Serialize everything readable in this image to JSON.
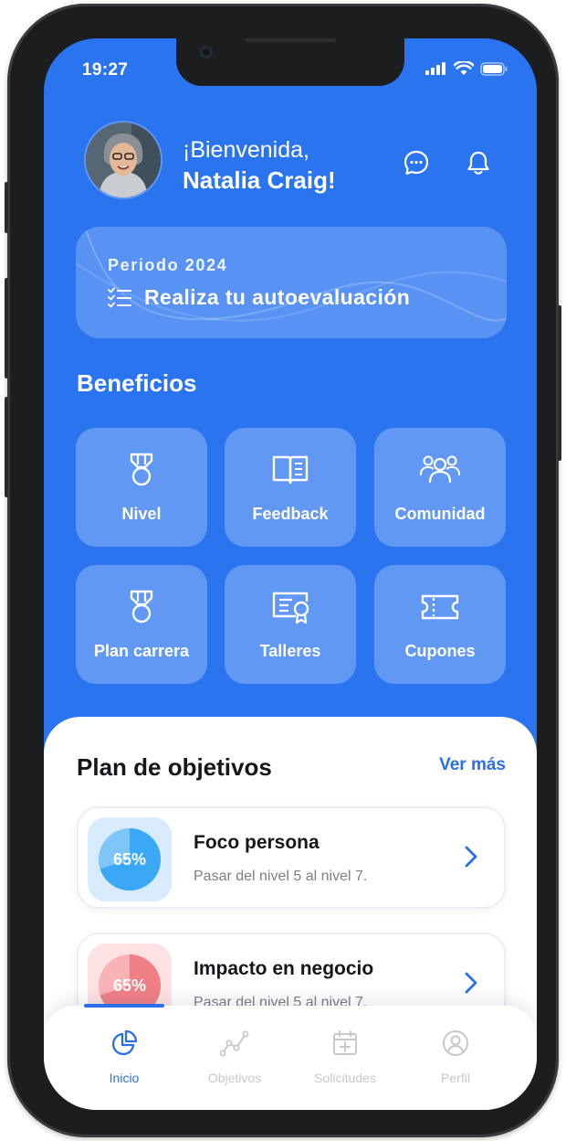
{
  "status_bar": {
    "time": "19:27"
  },
  "header": {
    "greeting": "¡Bienvenida,",
    "user_name": "Natalia Craig!"
  },
  "period_card": {
    "subtitle": "Periodo 2024",
    "cta_label": "Realiza tu autoevaluación"
  },
  "benefits": {
    "title": "Beneficios",
    "items": [
      {
        "label": "Nivel",
        "icon": "medal-icon"
      },
      {
        "label": "Feedback",
        "icon": "book-icon"
      },
      {
        "label": "Comunidad",
        "icon": "community-icon"
      },
      {
        "label": "Plan carrera",
        "icon": "medal-icon"
      },
      {
        "label": "Talleres",
        "icon": "certificate-icon"
      },
      {
        "label": "Cupones",
        "icon": "ticket-icon"
      }
    ]
  },
  "objectives": {
    "title": "Plan de objetivos",
    "see_more": "Ver más",
    "goals": [
      {
        "title": "Foco persona",
        "description": "Pasar del nivel 5 al nivel 7.",
        "progress_label": "65%",
        "progress": 0.65,
        "color": "#3aa8f5"
      },
      {
        "title": "Impacto en negocio",
        "description": "Pasar del nivel 5 al nivel 7.",
        "progress_label": "65%",
        "progress": 0.65,
        "color": "#f07f86"
      }
    ]
  },
  "bottom_nav": {
    "items": [
      {
        "label": "Inicio",
        "icon": "pie-chart-icon",
        "active": true
      },
      {
        "label": "Objetivos",
        "icon": "trend-icon",
        "active": false
      },
      {
        "label": "Solicitudes",
        "icon": "calendar-plus-icon",
        "active": false
      },
      {
        "label": "Perfil",
        "icon": "user-icon",
        "active": false
      }
    ]
  },
  "colors": {
    "primary": "#2a74f0",
    "accent": "#2a6fe8",
    "text_dark": "#15171c",
    "muted": "#7b8088"
  }
}
